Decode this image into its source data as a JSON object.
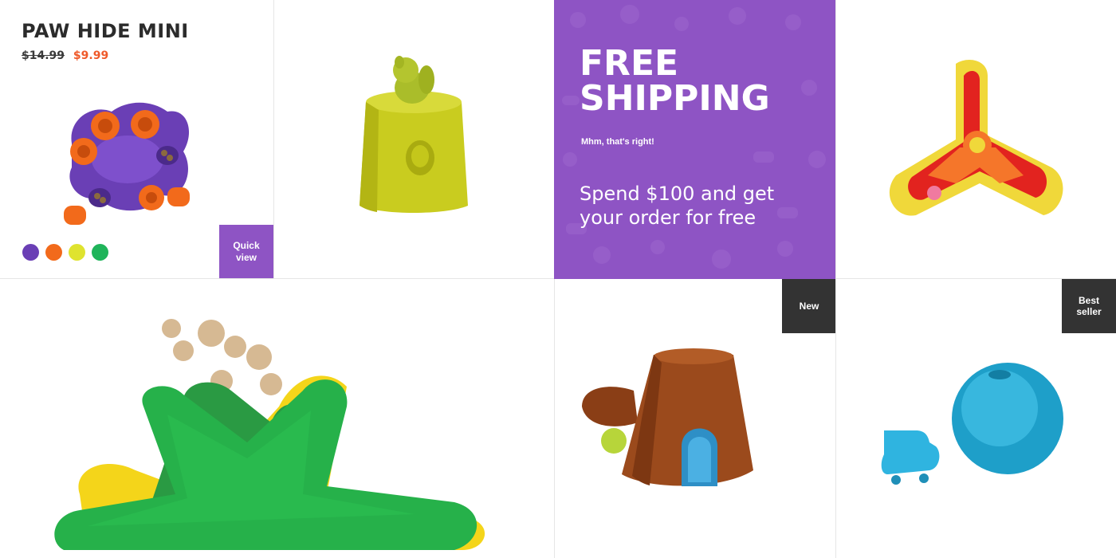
{
  "product": {
    "title": "PAW HIDE MINI",
    "price_old": "$14.99",
    "price_new": "$9.99",
    "swatches": [
      {
        "name": "purple",
        "color": "#6a3fb5"
      },
      {
        "name": "orange",
        "color": "#f26a1b"
      },
      {
        "name": "yellow",
        "color": "#dfe32f"
      },
      {
        "name": "green",
        "color": "#1fb45a"
      }
    ],
    "quick_view_label": "Quick\nview"
  },
  "promo": {
    "headline": "FREE\nSHIPPING",
    "subline": "Mhm, that's right!",
    "body": "Spend $100 and get\nyour order for free",
    "background_color": "#8e54c4"
  },
  "badges": {
    "new": "New",
    "best_seller": "Best\nseller"
  },
  "colors": {
    "accent_purple": "#8e54c4",
    "sale_red": "#ef5a2a",
    "badge_dark": "#333333"
  }
}
